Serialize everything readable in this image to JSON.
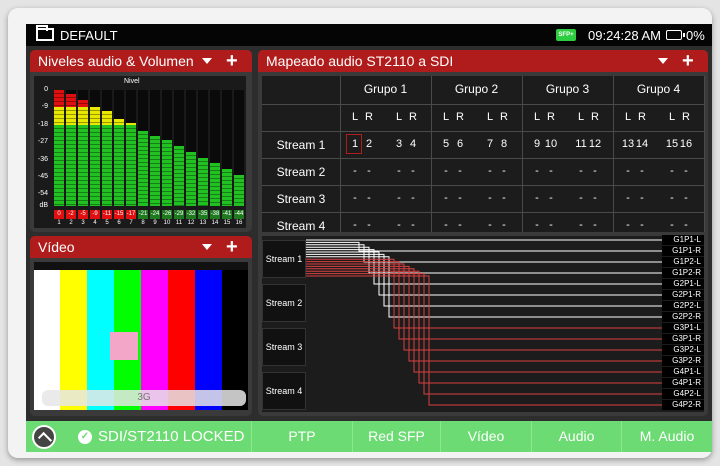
{
  "topbar": {
    "title": "DEFAULT",
    "sfp_badge": "SFP+",
    "time": "09:24:28 AM",
    "battery": "0%",
    "folder_icon": "folder-icon"
  },
  "audio_panel": {
    "title": "Niveles audio & Volumen",
    "meter_title": "Nivel",
    "db_scale": [
      "0",
      "-9",
      "-18",
      "-27",
      "-36",
      "-45",
      "-54",
      "dB"
    ],
    "channels": [
      {
        "n": "1",
        "level": "0"
      },
      {
        "n": "2",
        "level": "-2"
      },
      {
        "n": "3",
        "level": "-5"
      },
      {
        "n": "4",
        "level": "-9"
      },
      {
        "n": "5",
        "level": "-11"
      },
      {
        "n": "6",
        "level": "-15"
      },
      {
        "n": "7",
        "level": "-17"
      },
      {
        "n": "8",
        "level": "-21"
      },
      {
        "n": "9",
        "level": "-24"
      },
      {
        "n": "10",
        "level": "-26"
      },
      {
        "n": "11",
        "level": "-29"
      },
      {
        "n": "12",
        "level": "-32"
      },
      {
        "n": "13",
        "level": "-35"
      },
      {
        "n": "14",
        "level": "-38"
      },
      {
        "n": "15",
        "level": "-41"
      },
      {
        "n": "16",
        "level": "-44"
      }
    ]
  },
  "video_panel": {
    "title": "Vídeo",
    "format": "3G"
  },
  "map_panel": {
    "title": "Mapeado audio ST2110 a SDI",
    "groups": [
      "Grupo 1",
      "Grupo 2",
      "Grupo 3",
      "Grupo 4"
    ],
    "lr": [
      "L",
      "R"
    ],
    "streams": [
      {
        "name": "Stream 1",
        "values": [
          "1",
          "2",
          "3",
          "4",
          "5",
          "6",
          "7",
          "8",
          "9",
          "10",
          "11",
          "12",
          "13",
          "14",
          "15",
          "16"
        ]
      },
      {
        "name": "Stream 2",
        "values": [
          "-",
          "-",
          "-",
          "-",
          "-",
          "-",
          "-",
          "-",
          "-",
          "-",
          "-",
          "-",
          "-",
          "-",
          "-",
          "-"
        ]
      },
      {
        "name": "Stream 3",
        "values": [
          "-",
          "-",
          "-",
          "-",
          "-",
          "-",
          "-",
          "-",
          "-",
          "-",
          "-",
          "-",
          "-",
          "-",
          "-",
          "-"
        ]
      },
      {
        "name": "Stream 4",
        "values": [
          "-",
          "-",
          "-",
          "-",
          "-",
          "-",
          "-",
          "-",
          "-",
          "-",
          "-",
          "-",
          "-",
          "-",
          "-",
          "-"
        ]
      }
    ],
    "route_streams": [
      "Stream 1",
      "Stream 2",
      "Stream 3",
      "Stream 4"
    ],
    "outputs": [
      "G1P1-L",
      "G1P1-R",
      "G1P2-L",
      "G1P2-R",
      "G2P1-L",
      "G2P1-R",
      "G2P2-L",
      "G2P2-R",
      "G3P1-L",
      "G3P1-R",
      "G3P2-L",
      "G3P2-R",
      "G4P1-L",
      "G4P1-R",
      "G4P2-L",
      "G4P2-R"
    ]
  },
  "bottombar": {
    "status": "SDI/ST2110 LOCKED",
    "buttons": [
      "PTP",
      "Red SFP",
      "Vídeo",
      "Audio",
      "M. Audio"
    ]
  },
  "colors": {
    "accent_red": "#b01c1c",
    "status_green": "#6ddb73",
    "meter_green": "#22c122",
    "meter_yellow": "#e8e800",
    "meter_red": "#e01010"
  }
}
